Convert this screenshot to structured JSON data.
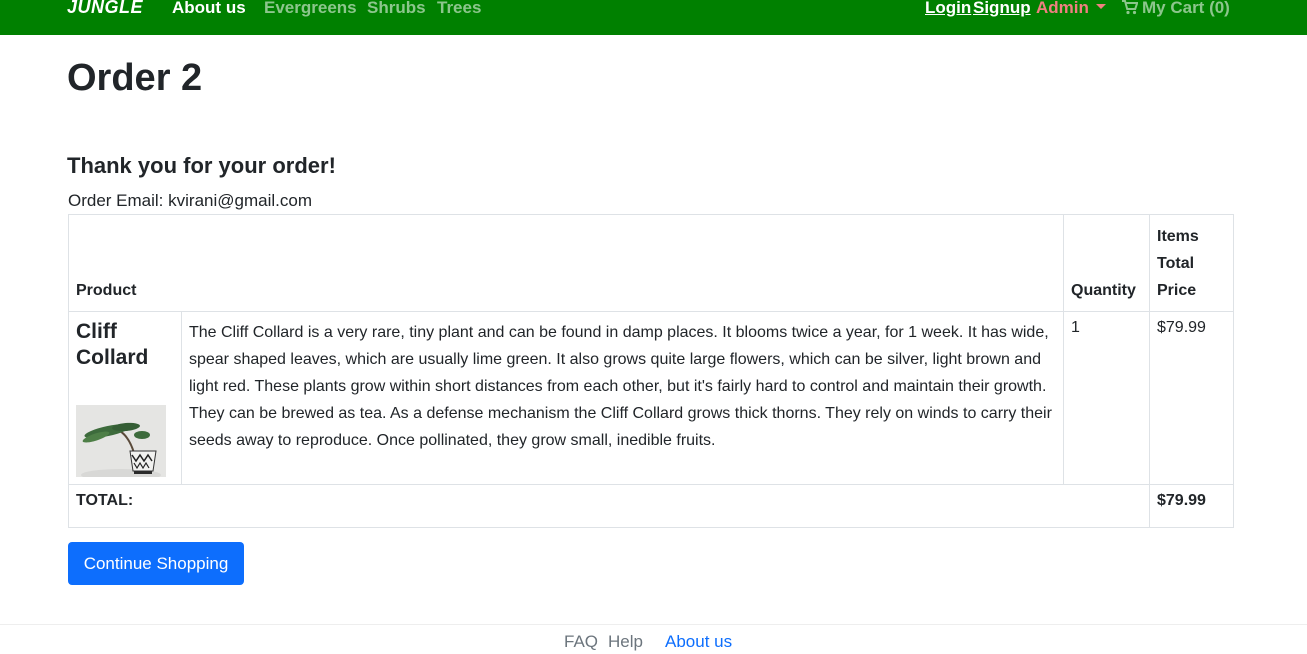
{
  "nav": {
    "brand": "JUNGLE",
    "about": "About us",
    "evergreens": "Evergreens",
    "shrubs": "Shrubs",
    "trees": "Trees",
    "login": "Login",
    "signup": "Signup",
    "admin": "Admin",
    "cart": "My Cart (0)",
    "cart_icon": "shopping-cart-icon",
    "colors": {
      "bar": "#008000",
      "admin": "#f08080"
    }
  },
  "main": {
    "title": "Order 2",
    "thanks": "Thank you for your order!",
    "email_line": "Order Email: kvirani@gmail.com"
  },
  "table": {
    "headers": {
      "product": "Product",
      "quantity": "Quantity",
      "items_total_price": "Items Total Price"
    },
    "rows": [
      {
        "name": "Cliff Collard",
        "description": "The Cliff Collard is a very rare, tiny plant and can be found in damp places. It blooms twice a year, for 1 week. It has wide, spear shaped leaves, which are usually lime green. It also grows quite large flowers, which can be silver, light brown and light red. These plants grow within short distances from each other, but it's fairly hard to control and maintain their growth. They can be brewed as tea. As a defense mechanism the Cliff Collard grows thick thorns. They rely on winds to carry their seeds away to reproduce. Once pollinated, they grow small, inedible fruits.",
        "quantity": "1",
        "price": "$79.99"
      }
    ],
    "total_label": "TOTAL:",
    "total_value": "$79.99"
  },
  "actions": {
    "continue": "Continue Shopping",
    "button_color": "#0d6efd"
  },
  "footer": {
    "faq": "FAQ",
    "help": "Help",
    "about": "About us"
  }
}
